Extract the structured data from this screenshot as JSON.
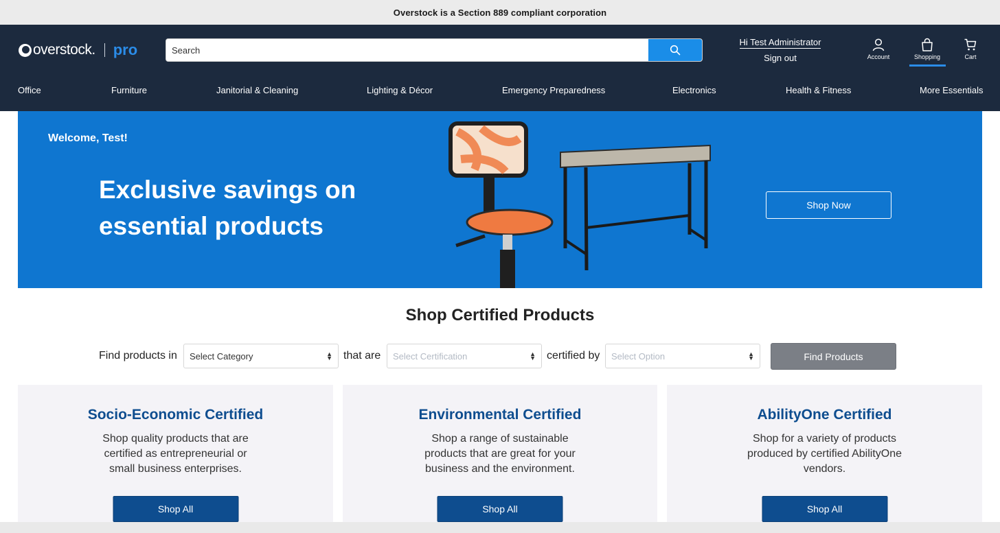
{
  "banner": {
    "text": "Overstock is a Section 889 compliant corporation"
  },
  "header": {
    "logo_word": "overstock.",
    "logo_pro": "pro",
    "search_placeholder": "Search",
    "user_greeting": "Hi Test Administrator",
    "sign_out": "Sign out",
    "icons": [
      {
        "label": "Account",
        "icon": "user-icon"
      },
      {
        "label": "Shopping",
        "icon": "shopping-bag-icon"
      },
      {
        "label": "Cart",
        "icon": "cart-icon"
      }
    ],
    "active_icon": "Shopping"
  },
  "nav": {
    "items": [
      "Office",
      "Furniture",
      "Janitorial & Cleaning",
      "Lighting & Décor",
      "Emergency Preparedness",
      "Electronics",
      "Health & Fitness",
      "More Essentials"
    ]
  },
  "hero": {
    "welcome": "Welcome, Test!",
    "title": "Exclusive savings on essential products",
    "cta": "Shop Now"
  },
  "certified": {
    "title": "Shop Certified Products",
    "finder": {
      "label_in": "Find products in",
      "label_are": "that are",
      "label_by": "certified by",
      "category_value": "Select Category",
      "certification_value": "Select Certification",
      "option_value": "Select Option",
      "button": "Find Products"
    },
    "cards": [
      {
        "title": "Socio-Economic Certified",
        "desc": "Shop quality products that are certified as entrepreneurial or small business enterprises.",
        "button": "Shop All"
      },
      {
        "title": "Environmental Certified",
        "desc": "Shop a range of sustainable products that are great for your business and the environment.",
        "button": "Shop All"
      },
      {
        "title": "AbilityOne Certified",
        "desc": "Shop for a variety of products produced by certified AbilityOne vendors.",
        "button": "Shop All"
      }
    ]
  },
  "colors": {
    "header_bg": "#1c2a3e",
    "accent": "#1a8de8",
    "hero_bg": "#0f76d0",
    "card_title": "#0e4d8f",
    "card_button": "#0e4d8f"
  }
}
